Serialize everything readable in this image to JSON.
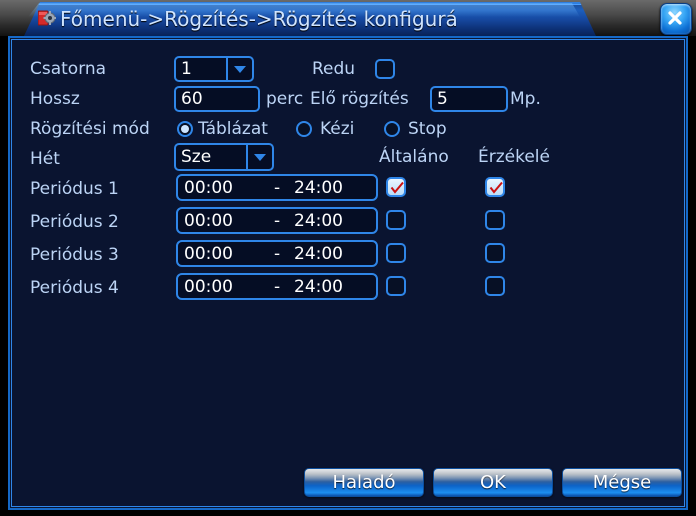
{
  "window": {
    "title": "Főmenü->Rögzítés->Rögzítés konfigurá",
    "app_icon": "gear-red-icon",
    "close_icon": "close-icon"
  },
  "form": {
    "channel_label": "Csatorna",
    "channel_value": "1",
    "redundancy_label": "Redu",
    "redundancy_checked": false,
    "length_label": "Hossz",
    "length_value": "60",
    "length_unit": "perc",
    "prerecord_label": "Elő rögzítés",
    "prerecord_value": "5",
    "prerecord_unit": "Mp.",
    "mode_label": "Rögzítési mód",
    "mode_options": [
      {
        "label": "Táblázat",
        "selected": true
      },
      {
        "label": "Kézi",
        "selected": false
      },
      {
        "label": "Stop",
        "selected": false
      }
    ],
    "week_label": "Hét",
    "week_value": "Sze",
    "col_general": "Általáno",
    "col_detect": "Érzékelé",
    "periods": [
      {
        "label": "Periódus 1",
        "start": "00:00",
        "separator": "-",
        "end": "24:00",
        "general": true,
        "detect": true
      },
      {
        "label": "Periódus 2",
        "start": "00:00",
        "separator": "-",
        "end": "24:00",
        "general": false,
        "detect": false
      },
      {
        "label": "Periódus 3",
        "start": "00:00",
        "separator": "-",
        "end": "24:00",
        "general": false,
        "detect": false
      },
      {
        "label": "Periódus 4",
        "start": "00:00",
        "separator": "-",
        "end": "24:00",
        "general": false,
        "detect": false
      }
    ]
  },
  "buttons": {
    "advanced": "Haladó",
    "ok": "OK",
    "cancel": "Mégse"
  },
  "colors": {
    "accent": "#2f86e8",
    "background": "#0a1430",
    "text": "#bcd4f5",
    "check": "#cc1111"
  }
}
